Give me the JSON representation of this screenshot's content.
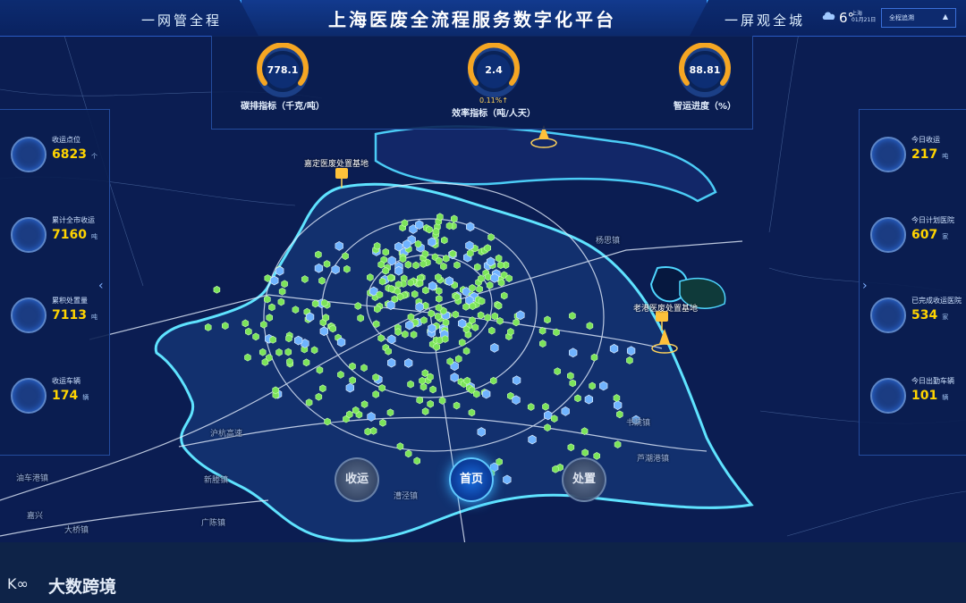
{
  "header": {
    "title": "上海医废全流程服务数字化平台",
    "slogan_left": "一网管全程",
    "slogan_right": "一屏观全城",
    "weather": {
      "icon": "cloud-icon",
      "temp": "6°",
      "line1": "上海",
      "line2": "01月21日"
    },
    "select_value": "全程追溯",
    "select_arrow": "▲"
  },
  "kpis": [
    {
      "value": "778.1",
      "label": "碳排指标（千克/吨）",
      "sub": ""
    },
    {
      "value": "2.4",
      "label": "效率指标（吨/人天）",
      "sub": "0.11%↑"
    },
    {
      "value": "88.81",
      "label": "智运进度（%）",
      "sub": ""
    }
  ],
  "left_stats": [
    {
      "icon": "home-plus-icon",
      "label": "收运点位",
      "value": "6823",
      "unit": "个"
    },
    {
      "icon": "biohazard-icon",
      "label": "累计全市收运",
      "value": "7160",
      "unit": "吨"
    },
    {
      "icon": "factory-icon",
      "label": "累积处置量",
      "value": "7113",
      "unit": "吨"
    },
    {
      "icon": "truck-icon",
      "label": "收运车辆",
      "value": "174",
      "unit": "辆"
    }
  ],
  "right_stats": [
    {
      "icon": "biohazard-icon",
      "label": "今日收运",
      "value": "217",
      "unit": "吨"
    },
    {
      "icon": "home-plus-icon",
      "label": "今日计划医院",
      "value": "607",
      "unit": "家"
    },
    {
      "icon": "send-icon",
      "label": "已完成收运医院",
      "value": "534",
      "unit": "家"
    },
    {
      "icon": "truck-icon",
      "label": "今日出勤车辆",
      "value": "101",
      "unit": "辆"
    }
  ],
  "map": {
    "sites": [
      "嘉定医废处置基地",
      "老港医废处置基地"
    ],
    "place_labels": [
      "油车港镇",
      "嘉兴",
      "大桥镇",
      "新塍镇",
      "沪杭高速",
      "广陈镇",
      "漕泾镇",
      "书院镇",
      "芦潮港镇",
      "杨思镇"
    ]
  },
  "nav": {
    "collect": "收运",
    "home": "首页",
    "dispose": "处置"
  },
  "brand": "大数跨境",
  "colors": {
    "accent": "#38b0ff",
    "value_yellow": "#ffd400",
    "boundary": "#5fe3ff",
    "marker_green": "#7be35a",
    "marker_blue": "#6fb3ff"
  }
}
